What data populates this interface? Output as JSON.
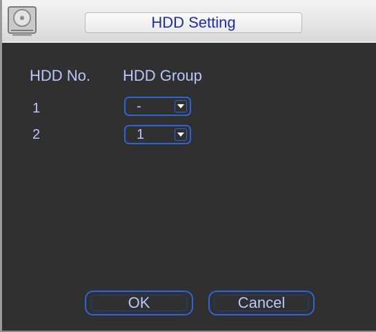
{
  "window": {
    "title": "HDD Setting",
    "title_icon": "hdd-icon"
  },
  "table": {
    "headers": [
      "HDD No.",
      "HDD Group"
    ],
    "rows": [
      {
        "no": "1",
        "group": "-"
      },
      {
        "no": "2",
        "group": "1"
      }
    ]
  },
  "buttons": {
    "ok_label": "OK",
    "cancel_label": "Cancel"
  },
  "colors": {
    "background": "#303030",
    "text": "#b8c8ff",
    "accent": "#2b66d8",
    "title_text": "#1a2bb8"
  },
  "icons": {
    "dropdown": "chevron-down-icon"
  }
}
